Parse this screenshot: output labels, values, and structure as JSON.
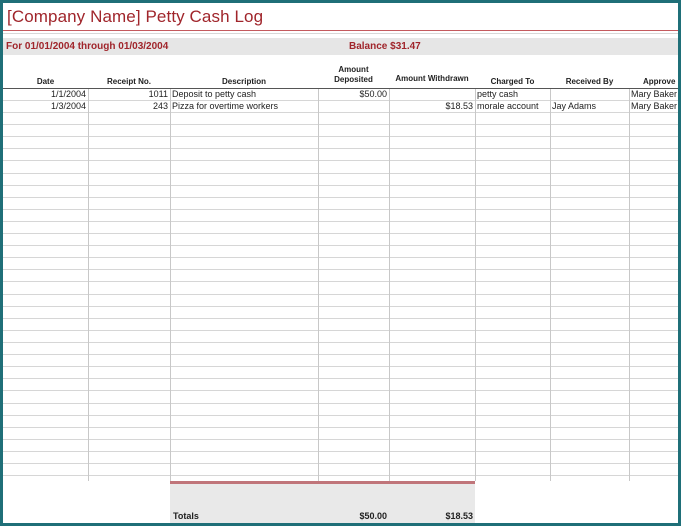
{
  "title": "[Company Name] Petty Cash Log",
  "period": "For 01/01/2004 through 01/03/2004",
  "balance": "Balance $31.47",
  "headers": {
    "date": "Date",
    "receipt": "Receipt No.",
    "description": "Description",
    "deposited_line1": "Amount",
    "deposited_line2": "Deposited",
    "withdrawn": "Amount Withdrawn",
    "charged_to": "Charged To",
    "received_by": "Received By",
    "approved_by": "Approve"
  },
  "rows": [
    {
      "date": "1/1/2004",
      "receipt": "1011",
      "description": "Deposit to petty cash",
      "deposited": "$50.00",
      "withdrawn": "",
      "charged_to": "petty cash",
      "received_by": "",
      "approved_by": "Mary Baker"
    },
    {
      "date": "1/3/2004",
      "receipt": "243",
      "description": "Pizza for overtime workers",
      "deposited": "",
      "withdrawn": "$18.53",
      "charged_to": "morale account",
      "received_by": "Jay Adams",
      "approved_by": "Mary Baker"
    }
  ],
  "totals": {
    "label": "Totals",
    "deposited": "$50.00",
    "withdrawn": "$18.53"
  }
}
